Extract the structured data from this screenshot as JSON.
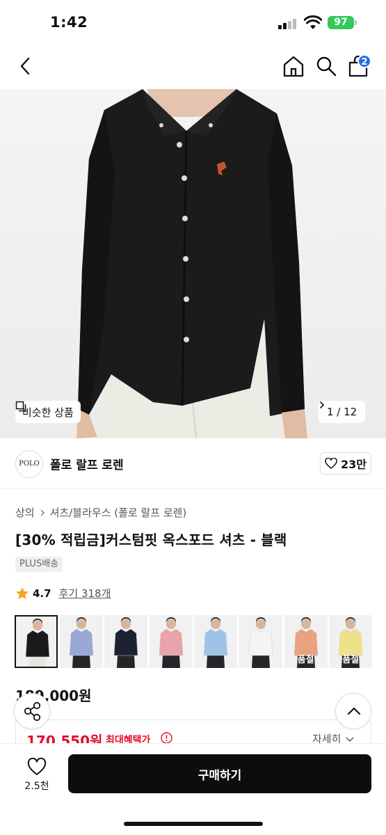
{
  "status_bar": {
    "time": "1:42",
    "battery": "97"
  },
  "nav": {
    "cart_count": "2"
  },
  "hero": {
    "similar_label": "비슷한 상품",
    "counter": "1 / 12"
  },
  "brand": {
    "logo_text": "POLO",
    "name": "폴로 랄프 로렌",
    "likes": "23만"
  },
  "breadcrumb": {
    "category": "상의",
    "subcategory": "셔츠/블라우스 (폴로 랄프 로렌)"
  },
  "product": {
    "title": "[30% 적립금]커스텀핏 옥스포드 셔츠 - 블랙",
    "badge": "PLUS배송",
    "rating": "4.7",
    "reviews": "후기 318개",
    "price": "189,000원"
  },
  "thumbnails": [
    {
      "shirt_color": "#1a1a1a",
      "sold_out": ""
    },
    {
      "shirt_color": "#9aa8d6",
      "sold_out": ""
    },
    {
      "shirt_color": "#1c2230",
      "sold_out": ""
    },
    {
      "shirt_color": "#e8a4a8",
      "sold_out": ""
    },
    {
      "shirt_color": "#9fc3e6",
      "sold_out": ""
    },
    {
      "shirt_color": "#f4f4f4",
      "sold_out": ""
    },
    {
      "shirt_color": "#e9a27e",
      "sold_out": "품절"
    },
    {
      "shirt_color": "#efe08a",
      "sold_out": "품절"
    }
  ],
  "benefit": {
    "price": "170,550원",
    "label": "최대혜택가",
    "detail": "자세히"
  },
  "bottom": {
    "fav_count": "2.5천",
    "buy_label": "구매하기"
  },
  "colors": {
    "accent_red": "#e0102a",
    "badge_blue": "#1f6feb",
    "battery_green": "#34c759"
  }
}
